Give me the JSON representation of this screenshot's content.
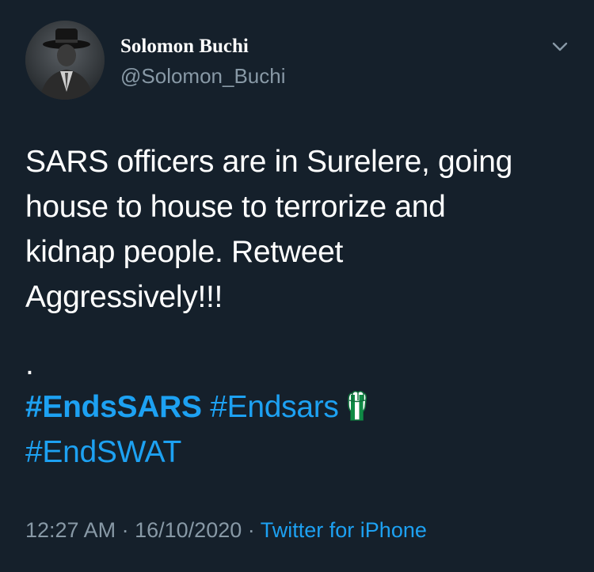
{
  "tweet": {
    "author": {
      "display_name": "Solomon Buchi",
      "handle": "@Solomon_Buchi",
      "avatar": "profile-photo"
    },
    "text_lines": [
      "SARS officers are in Surelere, going",
      "house to house to terrorize and",
      "kidnap people. Retweet",
      "Aggressively!!!"
    ],
    "separator": ".",
    "hashtags": {
      "primary": "#EndsSARS",
      "secondary": "#Endsars",
      "emoji": "raised-fist-nigeria-flag",
      "third": "#EndSWAT"
    },
    "meta": {
      "time": "12:27 AM",
      "sep1": "·",
      "date": "16/10/2020",
      "sep2": "·",
      "source": "Twitter for iPhone"
    },
    "menu_icon": "chevron-down-icon"
  },
  "colors": {
    "background": "#15202b",
    "text": "#ffffff",
    "secondary_text": "#8899a6",
    "link": "#1da1f2"
  }
}
